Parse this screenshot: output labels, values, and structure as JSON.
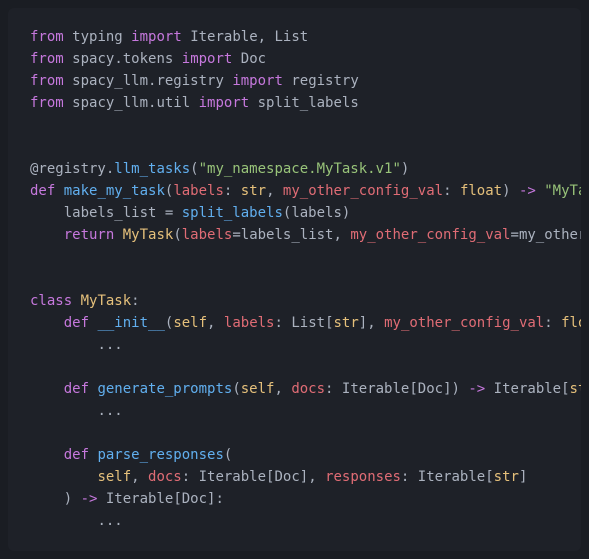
{
  "code": {
    "line1": {
      "kw1": "from",
      "mod": "typing",
      "kw2": "import",
      "names": "Iterable, List"
    },
    "line2": {
      "kw1": "from",
      "mod1": "spacy",
      "dot": ".",
      "mod2": "tokens",
      "kw2": "import",
      "names": "Doc"
    },
    "line3": {
      "kw1": "from",
      "mod1": "spacy_llm",
      "dot": ".",
      "mod2": "registry",
      "kw2": "import",
      "names": "registry"
    },
    "line4": {
      "kw1": "from",
      "mod1": "spacy_llm",
      "dot": ".",
      "mod2": "util",
      "kw2": "import",
      "names": "split_labels"
    },
    "line7": {
      "at": "@registry",
      "dot": ".",
      "fn": "llm_tasks",
      "op": "(",
      "str": "\"my_namespace.MyTask.v1\"",
      "cp": ")"
    },
    "line8": {
      "kw": "def",
      "fn": "make_my_task",
      "op": "(",
      "p1": "labels",
      "c1": ": ",
      "t1": "str",
      "comma1": ", ",
      "p2": "my_other_config_val",
      "c2": ": ",
      "t2": "float",
      "cp": ")",
      "arrow": " -> ",
      "ret": "\"MyTask\"",
      "end": ":"
    },
    "line9": {
      "indent": "    ",
      "lhs": "labels_list",
      "eq": " = ",
      "fn": "split_labels",
      "op": "(",
      "arg": "labels",
      "cp": ")"
    },
    "line10": {
      "indent": "    ",
      "kw": "return",
      "cls": "MyTask",
      "op": "(",
      "k1": "labels",
      "eq1": "=",
      "v1": "labels_list",
      "comma": ", ",
      "k2": "my_other_config_val",
      "eq2": "=",
      "v2": "my_other_con"
    },
    "line13": {
      "kw": "class",
      "name": "MyTask",
      "end": ":"
    },
    "line14": {
      "indent": "    ",
      "kw": "def",
      "fn": "__init__",
      "op": "(",
      "self": "self",
      "comma1": ", ",
      "p1": "labels",
      "c1": ": ",
      "t1a": "List",
      "br1": "[",
      "t1b": "str",
      "br2": "]",
      "comma2": ", ",
      "p2": "my_other_config_val",
      "c2": ": ",
      "t2": "float",
      "cp": ")",
      "end": ":"
    },
    "line15": {
      "indent": "        ",
      "dots": "..."
    },
    "line17": {
      "indent": "    ",
      "kw": "def",
      "fn": "generate_prompts",
      "op": "(",
      "self": "self",
      "comma1": ", ",
      "p1": "docs",
      "c1": ": ",
      "t1a": "Iterable",
      "br1": "[",
      "t1b": "Doc",
      "br2": "]",
      "cp": ")",
      "arrow": " -> ",
      "rt1": "Iterable",
      "rbr1": "[",
      "rt2": "str",
      "rbr2": "]",
      "end": ":"
    },
    "line18": {
      "indent": "        ",
      "dots": "..."
    },
    "line20": {
      "indent": "    ",
      "kw": "def",
      "fn": "parse_responses",
      "op": "("
    },
    "line21": {
      "indent": "        ",
      "self": "self",
      "comma1": ", ",
      "p1": "docs",
      "c1": ": ",
      "t1a": "Iterable",
      "br1": "[",
      "t1b": "Doc",
      "br2": "]",
      "comma2": ", ",
      "p2": "responses",
      "c2": ": ",
      "t2a": "Iterable",
      "br3": "[",
      "t2b": "str",
      "br4": "]"
    },
    "line22": {
      "indent": "    ",
      "cp": ")",
      "arrow": " -> ",
      "rt1": "Iterable",
      "rbr1": "[",
      "rt2": "Doc",
      "rbr2": "]",
      "end": ":"
    },
    "line23": {
      "indent": "        ",
      "dots": "..."
    }
  }
}
